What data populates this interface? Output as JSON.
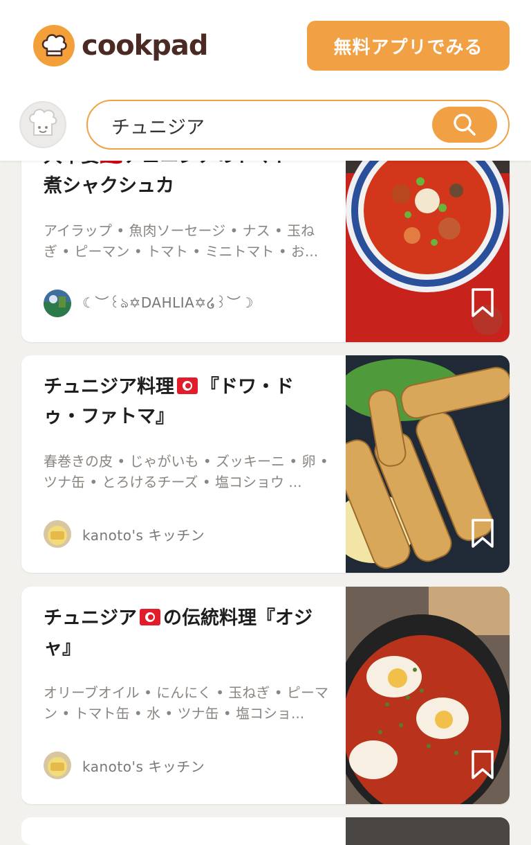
{
  "header": {
    "logo_text": "cookpad",
    "app_button_label": "無料アプリでみる"
  },
  "search": {
    "query": "チュニジア",
    "placeholder": ""
  },
  "recipes": [
    {
      "title_partial_line": "大不要🇹🇳チュニジアのトマト",
      "title_line2": "煮シャクシュカ",
      "ingredients": "アイラップ • 魚肉ソーセージ • ナス • 玉ねぎ • ピーマン • トマト • ミニトマト • お...",
      "author": "☾︎︶꒰ঌ✡︎DAHLIA✡︎໒꒱︶☽︎"
    },
    {
      "title_a": "チュニジア料理",
      "title_b": "『ドワ・ドゥ・ファトマ』",
      "ingredients": "春巻きの皮 • じゃがいも • ズッキーニ • 卵 • ツナ缶 • とろけるチーズ • 塩コショウ ...",
      "author": "kanoto's キッチン"
    },
    {
      "title_a": "チュニジア",
      "title_b": "の伝統料理『オジャ』",
      "ingredients": "オリーブオイル • にんにく • 玉ねぎ • ピーマン • トマト缶 • 水 • ツナ缶 • 塩コショ...",
      "author": "kanoto's キッチン"
    }
  ],
  "colors": {
    "accent": "#f1a043",
    "logo_text": "#4a2a22",
    "background": "#f3f1ee"
  }
}
